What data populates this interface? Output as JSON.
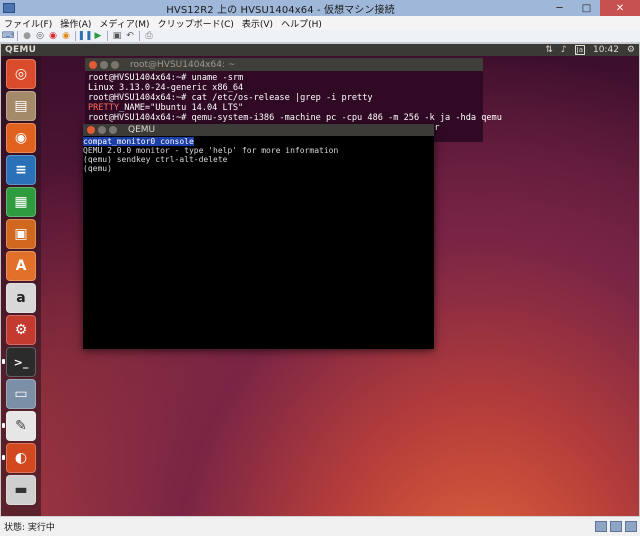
{
  "host": {
    "title": "HVS12R2 上の HVSU1404x64 - 仮想マシン接続",
    "window_buttons": {
      "minimize": "─",
      "maximize": "□",
      "close": "✕"
    },
    "menu": [
      "ファイル(F)",
      "操作(A)",
      "メディア(M)",
      "クリップボード(C)",
      "表示(V)",
      "ヘルプ(H)"
    ],
    "toolbar_icons": [
      "ctrl-alt-del-icon",
      "start-icon",
      "turn-off-icon",
      "shutdown-icon",
      "save-icon",
      "pause-icon",
      "resume-icon",
      "checkpoint-icon",
      "revert-icon",
      "enhanced-session-icon"
    ],
    "status": "状態: 実行中",
    "colors": {
      "titlebar": "#9fb8da",
      "close": "#c75050"
    }
  },
  "guest": {
    "panel": {
      "app_name": "QEMU",
      "keyboard": "Ja",
      "time": "10:42"
    },
    "launcher_items": [
      {
        "name": "ubuntu-dash-icon",
        "glyph": "◎",
        "color": "#d94b2a"
      },
      {
        "name": "files-icon",
        "glyph": "▤",
        "color": "#a58a6a"
      },
      {
        "name": "firefox-icon",
        "glyph": "◉",
        "color": "#e0621e"
      },
      {
        "name": "writer-icon",
        "glyph": "≡",
        "color": "#2a71b8"
      },
      {
        "name": "calc-icon",
        "glyph": "▦",
        "color": "#2f9b3f"
      },
      {
        "name": "impress-icon",
        "glyph": "▣",
        "color": "#d0681f"
      },
      {
        "name": "software-center-icon",
        "glyph": "A",
        "color": "#e0702a"
      },
      {
        "name": "amazon-icon",
        "glyph": "a",
        "color": "#d8d8d8"
      },
      {
        "name": "settings-icon",
        "glyph": "⚙",
        "color": "#c43a2f"
      },
      {
        "name": "terminal-icon",
        "glyph": ">_",
        "color": "#2b2b2b"
      },
      {
        "name": "remote-desktop-icon",
        "glyph": "▭",
        "color": "#7b8fa6"
      },
      {
        "name": "text-editor-icon",
        "glyph": "✎",
        "color": "#e6e6e6"
      },
      {
        "name": "qemu-icon",
        "glyph": "◐",
        "color": "#d2481f"
      },
      {
        "name": "floppy-icon",
        "glyph": "▬",
        "color": "#cfcfcf"
      }
    ],
    "terminal": {
      "title": "root@HVSU1404x64: ~",
      "lines": [
        "root@HVSU1404x64:~# uname -srm",
        "Linux 3.13.0-24-generic x86_64",
        "root@HVSU1404x64:~# cat /etc/os-release |grep -i pretty"
      ],
      "pretty_key": "PRETTY",
      "pretty_rest": "_NAME=\"Ubuntu 14.04 LTS\"",
      "cmd_line": "root@HVSU1404x64:~# qemu-system-i386 -machine pc -cpu 486 -m 256 -k ja -hda qemu",
      "cmd_tail": "ser"
    },
    "qemu": {
      "title": "QEMU",
      "tab": "compat_monitor0 console",
      "lines": [
        "QEMU 2.0.0 monitor - type 'help' for more information",
        "(qemu) sendkey ctrl-alt-delete",
        "(qemu)"
      ]
    }
  }
}
